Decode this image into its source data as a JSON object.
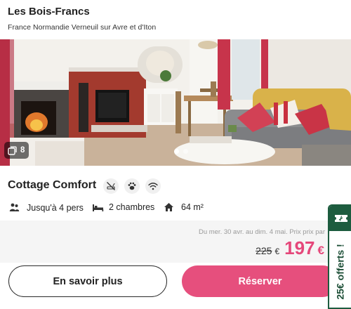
{
  "listing": {
    "name": "Les Bois-Francs",
    "location": "France Normandie Verneuil sur Avre et d'Iton"
  },
  "gallery": {
    "photo_count": "8",
    "total_dots": 2,
    "active_dot": 0
  },
  "cottage": {
    "title": "Cottage Comfort",
    "amenities": [
      "no-smoking-icon",
      "pets-icon",
      "wifi-icon"
    ]
  },
  "facts": {
    "capacity": "Jusqu'à 4 pers",
    "bedrooms": "2 chambres",
    "area": "64 m²"
  },
  "price": {
    "dates": "Du mer. 30 avr. au dim. 4 mai. Prix prix par",
    "old_value": "225",
    "old_currency": "€",
    "new_value": "197",
    "new_currency": "€"
  },
  "actions": {
    "more_label": "En savoir plus",
    "book_label": "Réserver"
  },
  "promo": {
    "label": "25€ offerts !"
  },
  "colors": {
    "accent": "#e64f7d",
    "price": "#e5477a",
    "promo_green": "#1d5c3f"
  }
}
